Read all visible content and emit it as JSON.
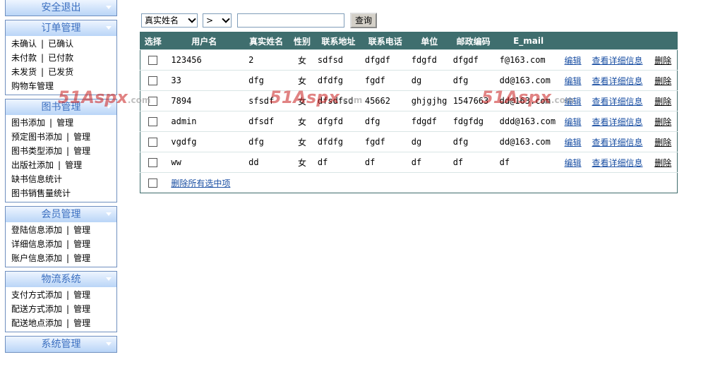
{
  "sidebar": {
    "logout": "安全退出",
    "order": {
      "title": "订单管理",
      "rows": [
        [
          "未确认",
          "已确认"
        ],
        [
          "未付款",
          "已付款"
        ],
        [
          "未发货",
          "已发货"
        ],
        [
          "购物车管理"
        ]
      ]
    },
    "books": {
      "title": "图书管理",
      "rows": [
        [
          "图书添加",
          "管理"
        ],
        [
          "预定图书添加",
          "管理"
        ],
        [
          "图书类型添加",
          "管理"
        ],
        [
          "出版社添加",
          "管理"
        ],
        [
          "缺书信息统计"
        ],
        [
          "图书销售量统计"
        ]
      ]
    },
    "members": {
      "title": "会员管理",
      "rows": [
        [
          "登陆信息添加",
          "管理"
        ],
        [
          "详细信息添加",
          "管理"
        ],
        [
          "账户信息添加",
          "管理"
        ]
      ]
    },
    "logistics": {
      "title": "物流系统",
      "rows": [
        [
          "支付方式添加",
          "管理"
        ],
        [
          "配送方式添加",
          "管理"
        ],
        [
          "配送地点添加",
          "管理"
        ]
      ]
    },
    "system": {
      "title": "系统管理"
    },
    "separator": "|"
  },
  "search": {
    "field_selected": "真实姓名",
    "operator_selected": ">",
    "query_value": "",
    "button": "查询"
  },
  "table": {
    "headers": [
      "选择",
      "用户名",
      "真实姓名",
      "性别",
      "联系地址",
      "联系电话",
      "单位",
      "邮政编码",
      "E_mail"
    ],
    "rows": [
      [
        "123456",
        "2",
        "女",
        "sdfsd",
        "dfgdf",
        "fdgfd",
        "dfgdf",
        "f@163.com"
      ],
      [
        "33",
        "dfg",
        "女",
        "dfdfg",
        "fgdf",
        "dg",
        "dfg",
        "dd@163.com"
      ],
      [
        "7894",
        "sfsdf",
        "女",
        "dfsdfsd",
        "45662",
        "ghjgjhg",
        "1547663",
        "dd@163.com"
      ],
      [
        "admin",
        "dfsdf",
        "女",
        "dfgfd",
        "dfg",
        "fdgdf",
        "fdgfdg",
        "ddd@163.com"
      ],
      [
        "vgdfg",
        "dfg",
        "女",
        "dfdfg",
        "fgdf",
        "dg",
        "dfg",
        "dd@163.com"
      ],
      [
        "ww",
        "dd",
        "女",
        "df",
        "df",
        "df",
        "df",
        "df"
      ]
    ],
    "actions": [
      "编辑",
      "查看详细信息",
      "删除"
    ],
    "delete_selected": "删除所有选中项"
  },
  "watermark": {
    "brand": "51Aspx",
    "suffix": ".com"
  },
  "colors": {
    "header_bg": "#3f6e6e",
    "link": "#1a4fa3",
    "panel_title": "#3b6fc0"
  }
}
